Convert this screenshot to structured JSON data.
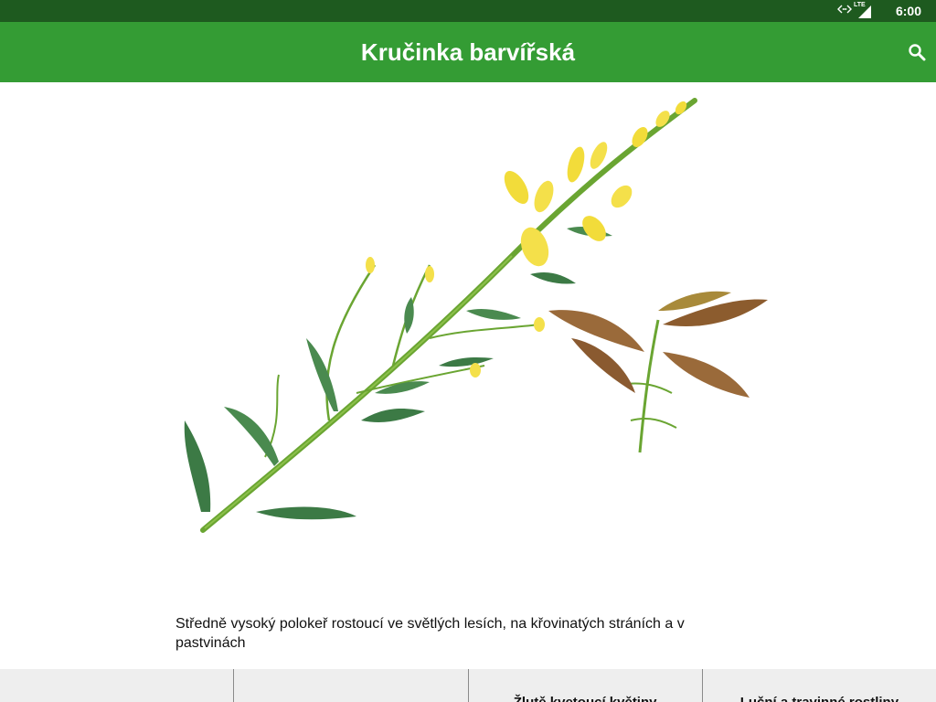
{
  "status_bar": {
    "time": "6:00",
    "network_label": "LTE",
    "icons": [
      "data-transfer-icon",
      "lte-signal-icon"
    ]
  },
  "app_bar": {
    "title": "Kručinka barvířská",
    "search_icon": "search-icon"
  },
  "main": {
    "image_subject": "Kručinka barvířská",
    "description": "Středně vysoký polokeř rostoucí ve světlých lesích, na křovinatých stráních a v pastvinách"
  },
  "bottom_tabs": [
    {
      "label": ""
    },
    {
      "label": ""
    },
    {
      "label": "Žlutě kvetoucí květiny"
    },
    {
      "label": "Luční a travinné rostliny"
    }
  ],
  "colors": {
    "status_bar": "#1e5a1f",
    "app_bar": "#349c34",
    "bottom_bar": "#eeeeee"
  }
}
